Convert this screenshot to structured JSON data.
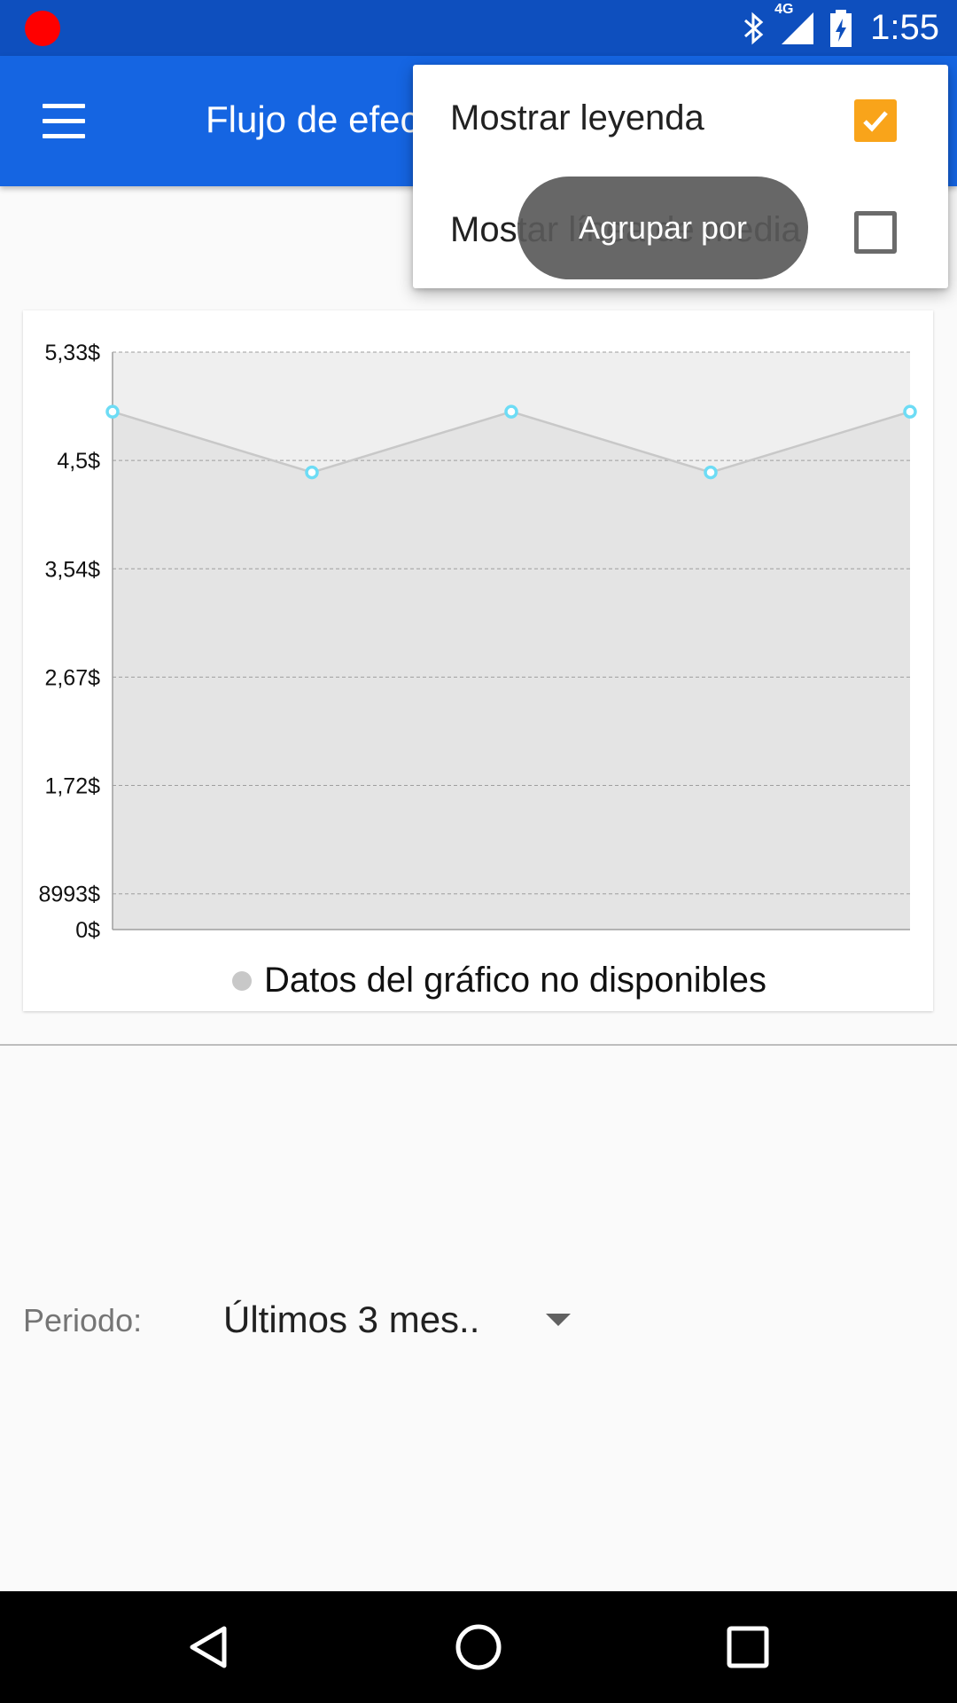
{
  "status_bar": {
    "time": "1:55",
    "network": "4G",
    "icons": [
      "record-indicator-icon",
      "bluetooth-icon",
      "signal-icon",
      "battery-charging-icon"
    ]
  },
  "app_bar": {
    "title": "Flujo de efectivo",
    "menu_icon": "hamburger-menu-icon"
  },
  "popup_menu": {
    "items": [
      {
        "label": "Mostrar leyenda",
        "checked": true
      },
      {
        "label": "Mostar línea de media",
        "checked": false
      }
    ]
  },
  "toast": {
    "text": "Agrupar por"
  },
  "chart_data": {
    "type": "area",
    "x": [
      1,
      2,
      3,
      4,
      5
    ],
    "y_tick_labels": [
      "5,33$",
      "4,5$",
      "3,54$",
      "2,67$",
      "1,72$",
      "8993$",
      "0$"
    ],
    "y_tick_values": [
      5.33,
      4.33,
      3.33,
      2.33,
      1.33,
      0.33,
      0
    ],
    "series": [
      {
        "values": [
          4.78,
          4.22,
          4.78,
          4.22,
          4.78
        ]
      }
    ],
    "ylim": [
      0,
      5.33
    ],
    "grid": true,
    "legend": {
      "position": "bottom-center",
      "entries": [
        "Datos del gráfico no disponibles"
      ]
    },
    "colors": {
      "fill": "#e4e4e4",
      "line": "#c8c8c8",
      "marker": "#6ddcf5"
    }
  },
  "period": {
    "label": "Periodo:",
    "value": "Últimos 3 mes.."
  },
  "nav_bar": {
    "icons": [
      "back-icon",
      "home-icon",
      "recents-icon"
    ]
  }
}
